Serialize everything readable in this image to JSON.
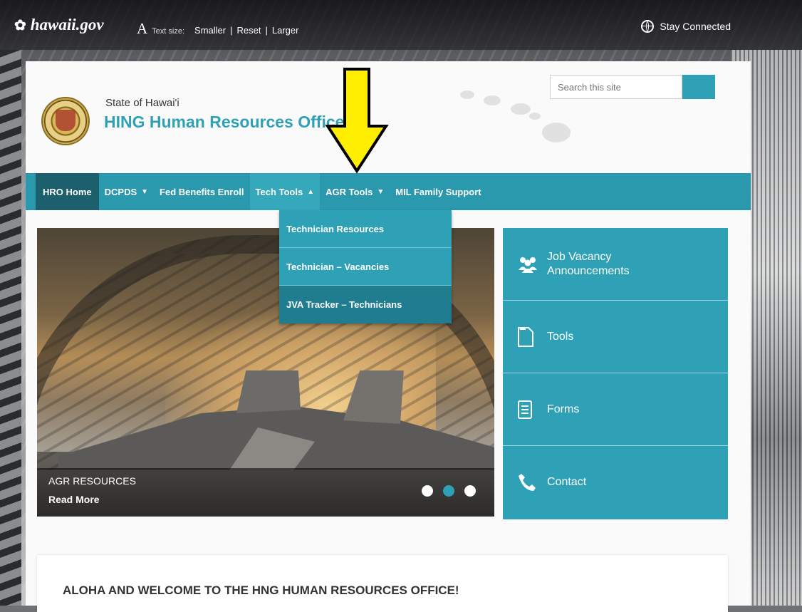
{
  "topbar": {
    "gov_logo": "hawaii.gov",
    "text_size_icon": "A",
    "text_size_label": "Text size:",
    "smaller": "Smaller",
    "reset": "Reset",
    "larger": "Larger",
    "separator": "|",
    "stay_connected": "Stay Connected",
    "icons": [
      "flower-logo-icon",
      "text-size-icon",
      "globe-icon"
    ]
  },
  "header": {
    "state": "State of Hawai'i",
    "office": "HING Human Resources Office",
    "search_placeholder": "Search this site"
  },
  "nav": {
    "items": [
      {
        "label": "HRO Home",
        "caret": ""
      },
      {
        "label": "DCPDS",
        "caret": "▼"
      },
      {
        "label": "Fed Benefits Enroll",
        "caret": ""
      },
      {
        "label": "Tech Tools",
        "caret": "▲"
      },
      {
        "label": "AGR Tools",
        "caret": "▼"
      },
      {
        "label": "MIL Family Support",
        "caret": ""
      }
    ]
  },
  "dropdown": {
    "items": [
      "Technician Resources",
      "Technician – Vacancies",
      "JVA Tracker – Technicians"
    ]
  },
  "slider": {
    "title": "AGR RESOURCES",
    "read_more": "Read More",
    "active_slide": 2,
    "slide_count": 3
  },
  "quick_links": [
    {
      "label": "Job Vacancy Announcements",
      "icon": "users-icon"
    },
    {
      "label": "Tools",
      "icon": "document-icon"
    },
    {
      "label": "Forms",
      "icon": "form-icon"
    },
    {
      "label": "Contact",
      "icon": "phone-icon"
    }
  ],
  "welcome": {
    "heading": "ALOHA AND WELCOME TO THE HNG HUMAN RESOURCES OFFICE!"
  },
  "colors": {
    "accent": "#2ea1b6",
    "nav": "#2b99ad",
    "nav_home": "#1c5f6d",
    "arrow": "#ffee00"
  }
}
